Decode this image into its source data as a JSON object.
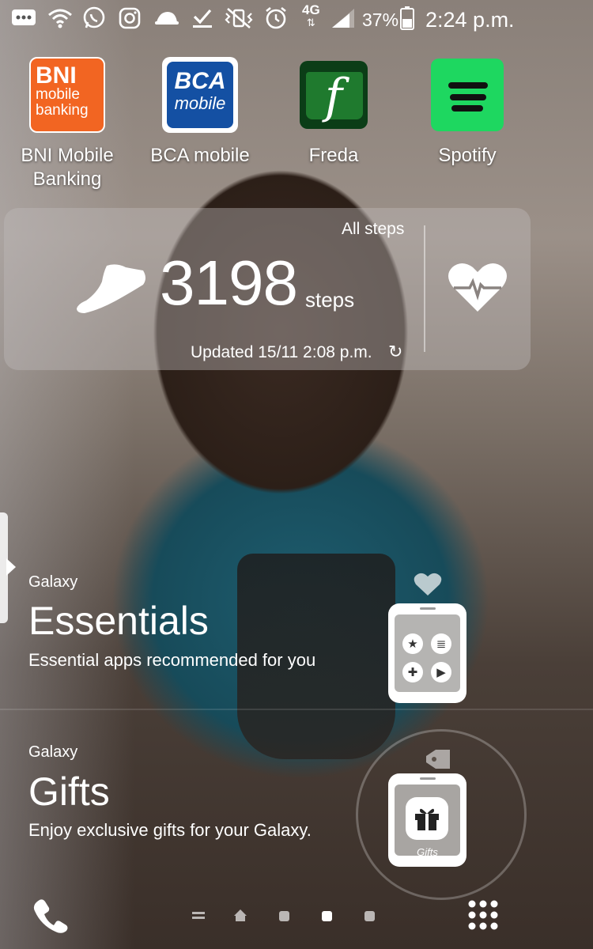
{
  "status_bar": {
    "icons": [
      "messages-icon",
      "wifi-icon",
      "whatsapp-icon",
      "instagram-icon",
      "turtle-icon",
      "download-done-icon",
      "vibrate-off-icon",
      "alarm-icon"
    ],
    "network": "4G",
    "battery_percent": "37%",
    "time": "2:24 p.m."
  },
  "apps": [
    {
      "name": "BNI Mobile Banking",
      "icon_text": [
        "BNI",
        "mobile",
        "banking"
      ],
      "label_line1": "BNI Mobile",
      "label_line2": "Banking"
    },
    {
      "name": "BCA mobile",
      "icon_text": [
        "BCA",
        "mobile"
      ]
    },
    {
      "name": "Freda",
      "icon_text": [
        "f"
      ]
    },
    {
      "name": "Spotify"
    }
  ],
  "steps_widget": {
    "header": "All steps",
    "count": "3198",
    "unit": "steps",
    "updated": "Updated 15/11 2:08 p.m."
  },
  "essentials": {
    "brand": "Galaxy",
    "title": "Essentials",
    "description": "Essential apps recommended for you"
  },
  "gifts": {
    "brand": "Galaxy",
    "title": "Gifts",
    "description": "Enjoy exclusive gifts for your Galaxy.",
    "screen_label": "Gifts"
  },
  "colors": {
    "bni_orange": "#f26522",
    "bca_blue": "#1450a3",
    "freda_green": "#0b3d17",
    "spotify_green": "#1ed760"
  }
}
